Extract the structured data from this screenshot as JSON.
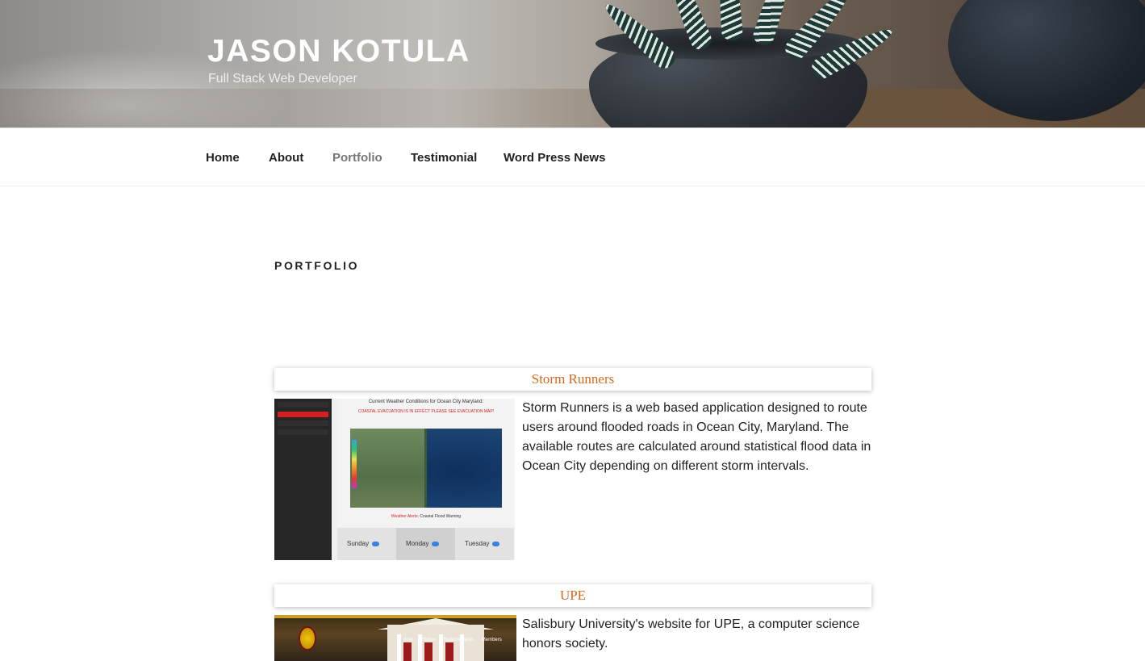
{
  "header": {
    "site_title": "JASON KOTULA",
    "site_description": "Full Stack Web Developer"
  },
  "nav": {
    "items": [
      {
        "label": "Home",
        "active": false
      },
      {
        "label": "About",
        "active": false
      },
      {
        "label": "Portfolio",
        "active": true
      },
      {
        "label": "Testimonial",
        "active": false
      },
      {
        "label": "Word Press News",
        "active": false
      }
    ]
  },
  "page": {
    "title": "PORTFOLIO"
  },
  "projects": [
    {
      "title": "Storm Runners",
      "description": "Storm Runners is a web based application designed to route users around flooded roads in Ocean City, Maryland. The available routes are calculated around statistical flood data in Ocean City depending on different storm intervals.",
      "thumbnail": {
        "heading": "Current Weather Conditions for Ocean City Maryland:",
        "alert": "COASTAL EVACUATION IS IN EFFECT PLEASE SEE EVACUATION MAP!",
        "weather_alert_label": "Weather Alerts:",
        "weather_alert_value": "Coastal Flood Warning",
        "days": [
          "Sunday",
          "Monday",
          "Tuesday"
        ]
      }
    },
    {
      "title": "UPE",
      "description": "Salisbury University's website for UPE, a computer science honors society.",
      "thumbnail": {
        "nav": [
          "ome",
          "Photos",
          "Requirements",
          "Members"
        ]
      }
    }
  ],
  "colors": {
    "project_title": "#d2691e",
    "nav_active": "#767676",
    "text": "#222222"
  }
}
